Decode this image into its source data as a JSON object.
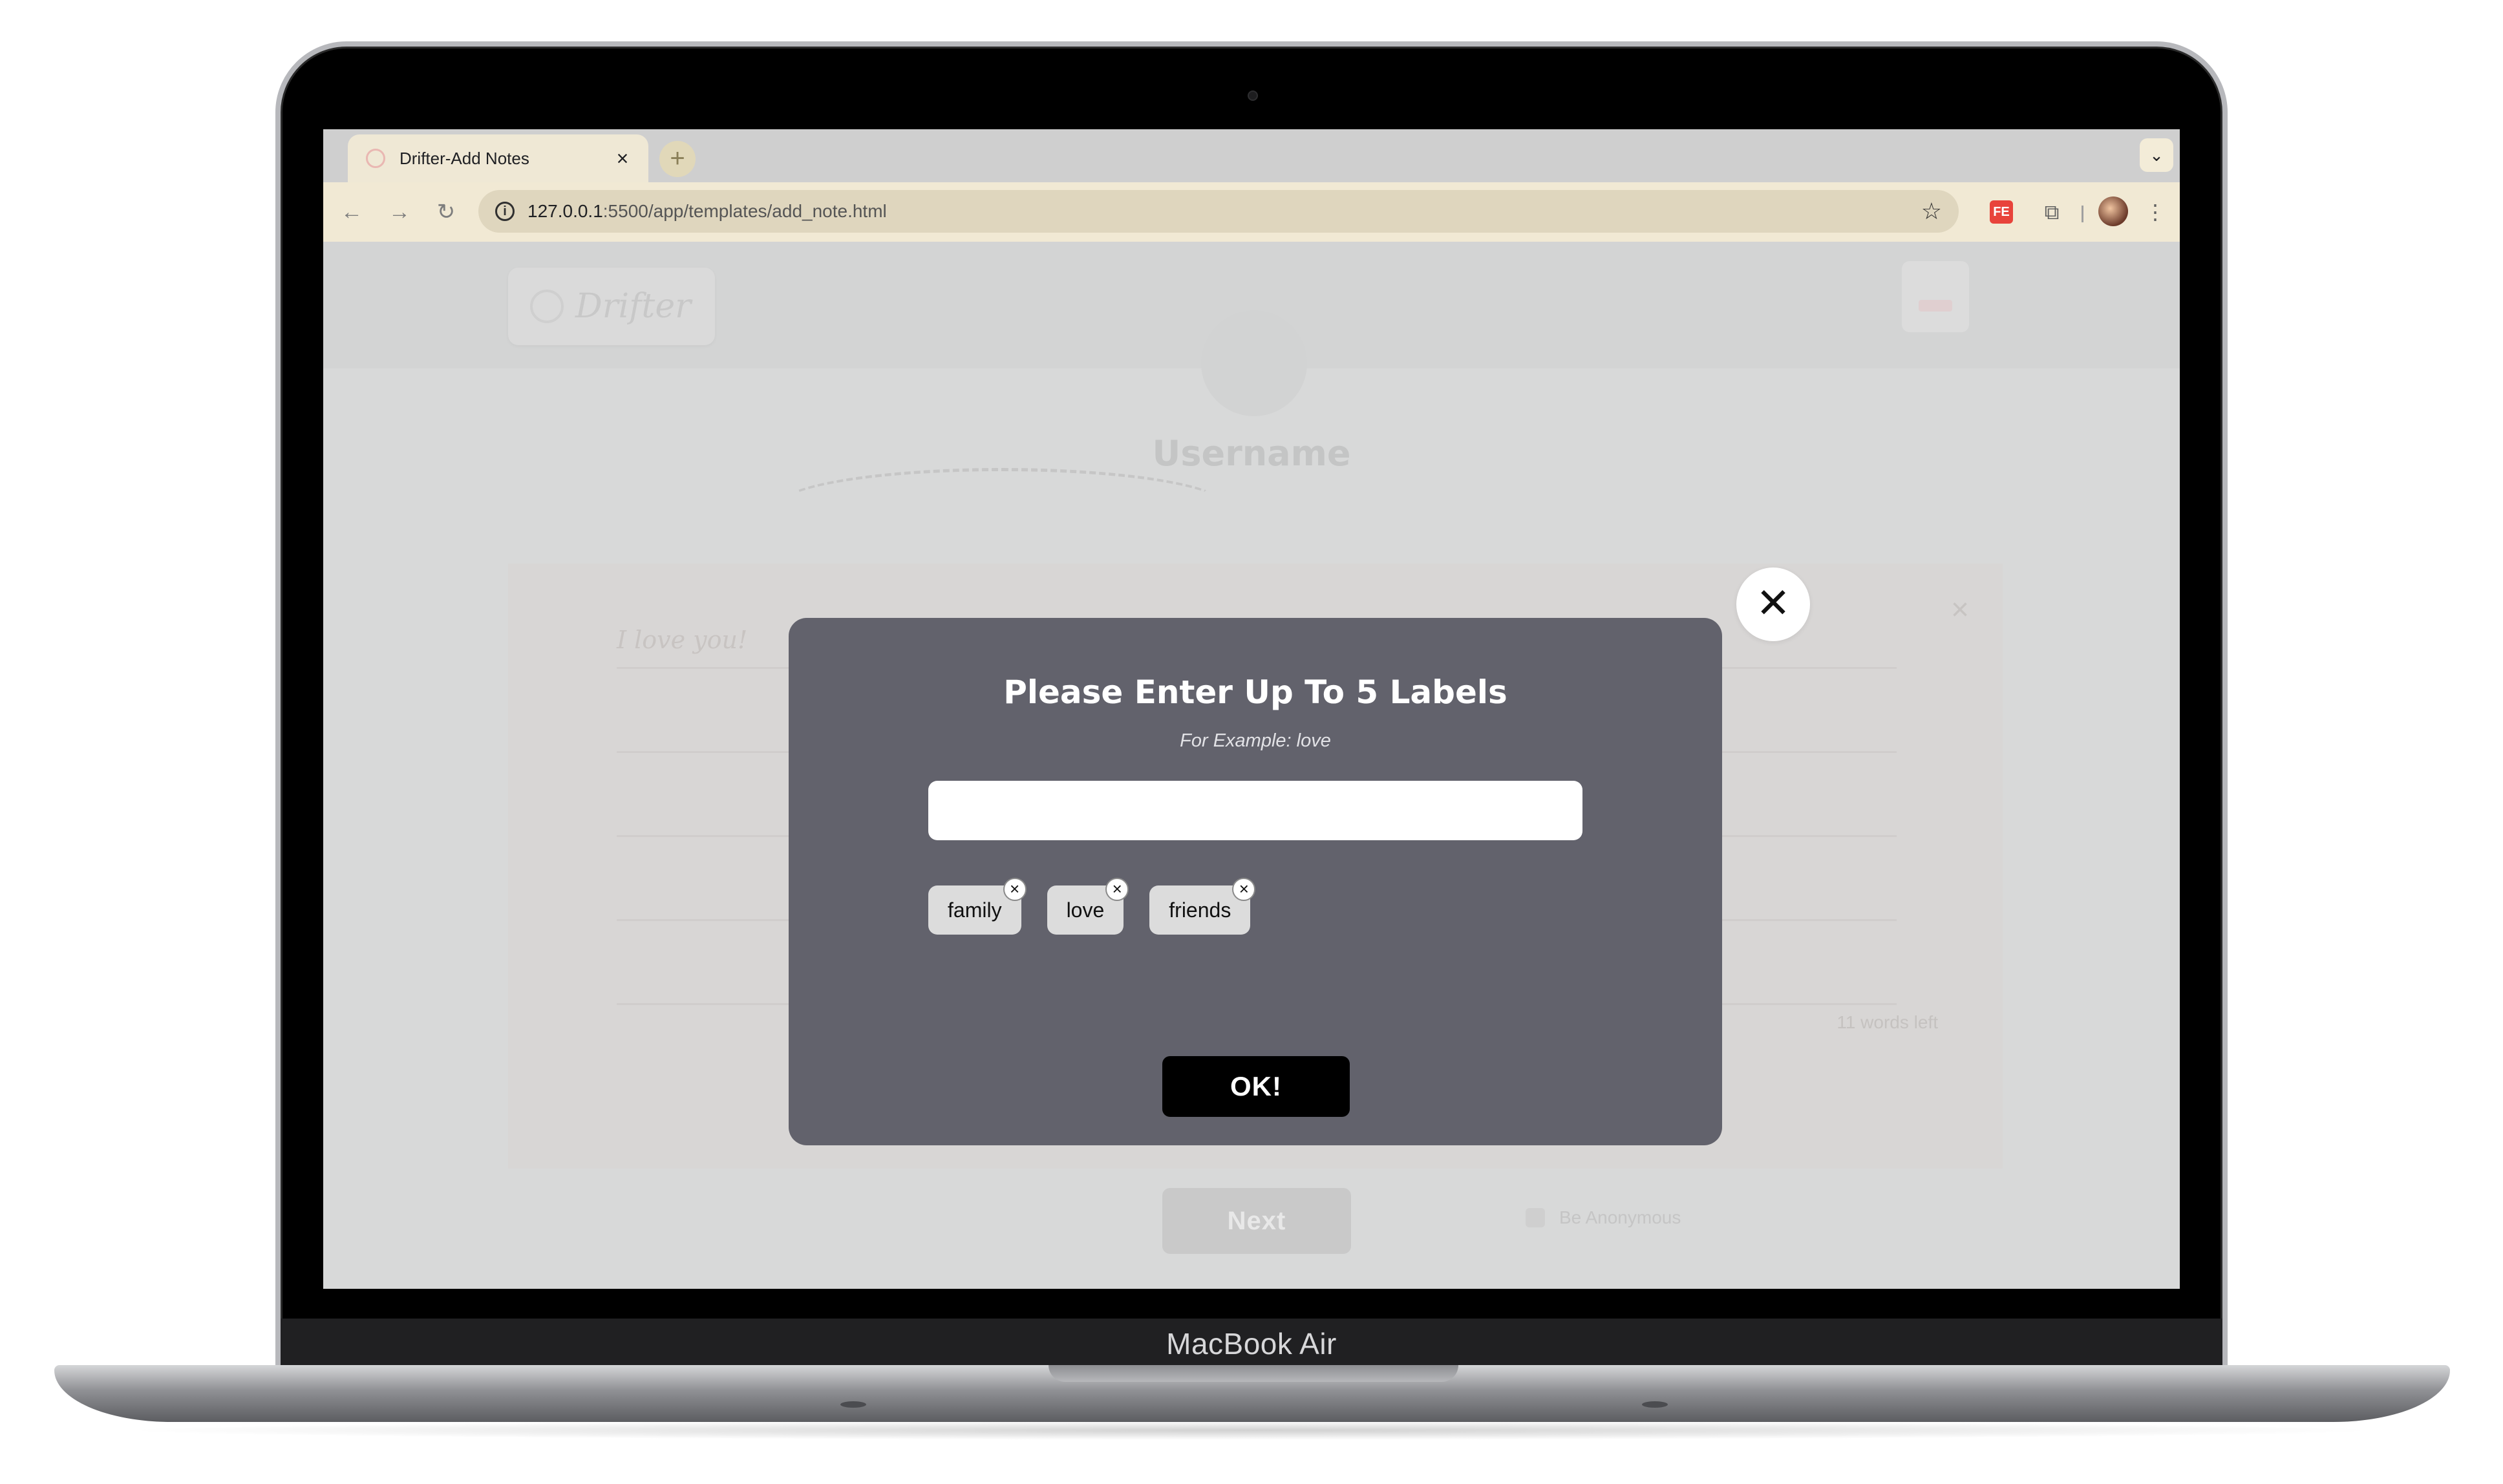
{
  "browser": {
    "tab_title": "Drifter-Add Notes",
    "tab_close": "×",
    "new_tab": "+",
    "tab_menu": "⌄",
    "url_host": "127.0.0.1",
    "url_path": ":5500/app/templates/add_note.html",
    "back_icon": "←",
    "forward_icon": "→",
    "reload_icon": "↻",
    "info_icon": "i",
    "star_icon": "☆",
    "extension_label": "FE",
    "puzzle_icon": "⧉",
    "menu_icon": "⋮"
  },
  "page": {
    "logo_text": "Drifter",
    "username": "Username",
    "note_placeholder": "I love you!",
    "note_close": "×",
    "word_count": "11 words left",
    "next_label": "Next",
    "anonymous_label": "Be Anonymous"
  },
  "modal": {
    "title": "Please Enter Up To 5 Labels",
    "subtitle": "For Example: love",
    "input_value": "",
    "labels": [
      "family",
      "love",
      "friends"
    ],
    "chip_remove": "×",
    "ok_label": "OK!",
    "close_icon": "✕"
  },
  "device": {
    "label": "MacBook Air"
  },
  "colors": {
    "modal_bg": "#62626c",
    "overlay_bg": "#d8d9d9",
    "ok_button": "#000000",
    "chip_bg": "#dcdcdc",
    "browser_toolbar": "#f1e9d4"
  }
}
